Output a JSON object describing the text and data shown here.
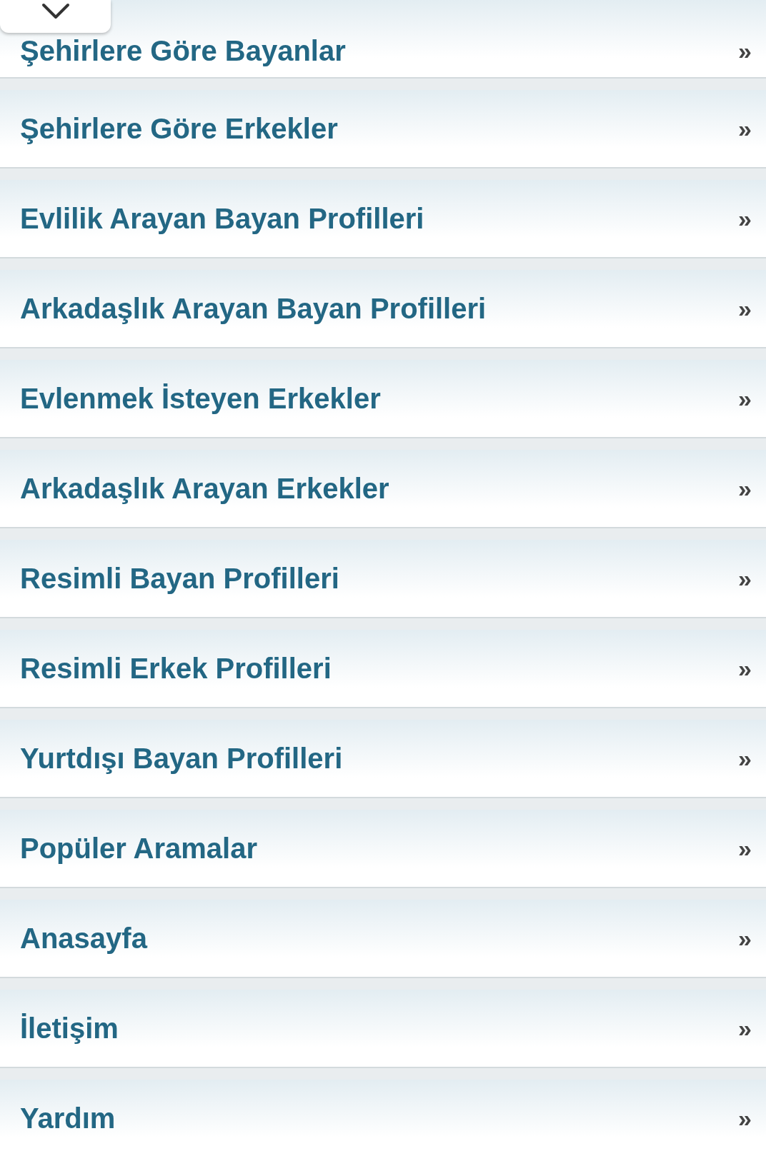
{
  "items": [
    {
      "label": "Şehirlere Göre Bayanlar",
      "icon": "»"
    },
    {
      "label": "Şehirlere Göre Erkekler",
      "icon": "»"
    },
    {
      "label": "Evlilik Arayan Bayan Profilleri",
      "icon": "»"
    },
    {
      "label": "Arkadaşlık Arayan Bayan Profilleri",
      "icon": "»"
    },
    {
      "label": "Evlenmek İsteyen Erkekler",
      "icon": "»"
    },
    {
      "label": "Arkadaşlık Arayan Erkekler",
      "icon": "»"
    },
    {
      "label": "Resimli Bayan Profilleri",
      "icon": "»"
    },
    {
      "label": "Resimli Erkek Profilleri",
      "icon": "»"
    },
    {
      "label": "Yurtdışı Bayan Profilleri",
      "icon": "»"
    },
    {
      "label": "Popüler Aramalar",
      "icon": "»"
    },
    {
      "label": "Anasayfa",
      "icon": "»"
    },
    {
      "label": "İletişim",
      "icon": "»"
    },
    {
      "label": "Yardım",
      "icon": "»"
    }
  ]
}
